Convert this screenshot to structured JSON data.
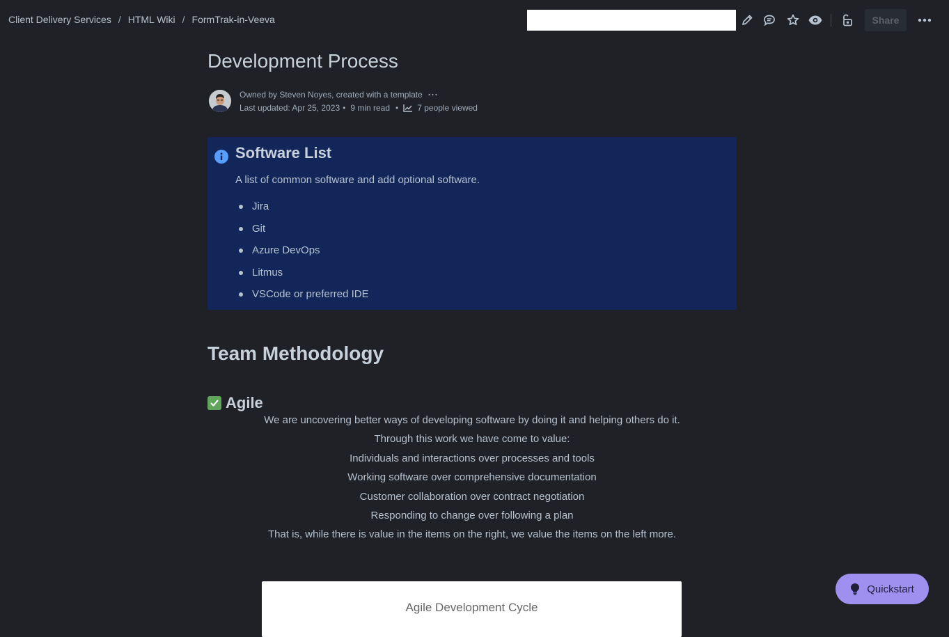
{
  "breadcrumb": {
    "items": [
      "Client Delivery Services",
      "HTML Wiki",
      "FormTrak-in-Veeva"
    ],
    "separator": "/"
  },
  "toolbar": {
    "search_value": "",
    "icons": [
      "edit-icon",
      "comment-icon",
      "star-icon",
      "watch-icon",
      "restrictions-icon",
      "more-icon"
    ],
    "share_label": "Share"
  },
  "page": {
    "title": "Development Process",
    "byline": {
      "owner_text": "Owned by Steven Noyes, created with a template",
      "last_updated": "Last updated: Apr 25, 2023",
      "read_time": "9 min read",
      "views": "7 people viewed"
    }
  },
  "info_panel": {
    "heading": "Software List",
    "description": "A list of common software and add optional software.",
    "items": [
      "Jira",
      "Git",
      "Azure DevOps",
      "Litmus",
      "VSCode or preferred IDE"
    ],
    "color": "#13265a"
  },
  "methodology": {
    "heading": "Team Methodology",
    "agile_heading": "Agile",
    "manifesto": [
      "We are uncovering better ways of developing software by doing it and helping others do it.",
      "Through this work we have come to value:",
      "Individuals and interactions over processes and tools",
      "Working software over comprehensive documentation",
      "Customer collaboration over contract negotiation",
      "Responding to change over following a plan",
      "That is, while there is value in the items on the right, we value the items on the left more."
    ],
    "diagram_title": "Agile Development Cycle"
  },
  "quickstart": {
    "label": "Quickstart",
    "color": "#9f8fef"
  }
}
